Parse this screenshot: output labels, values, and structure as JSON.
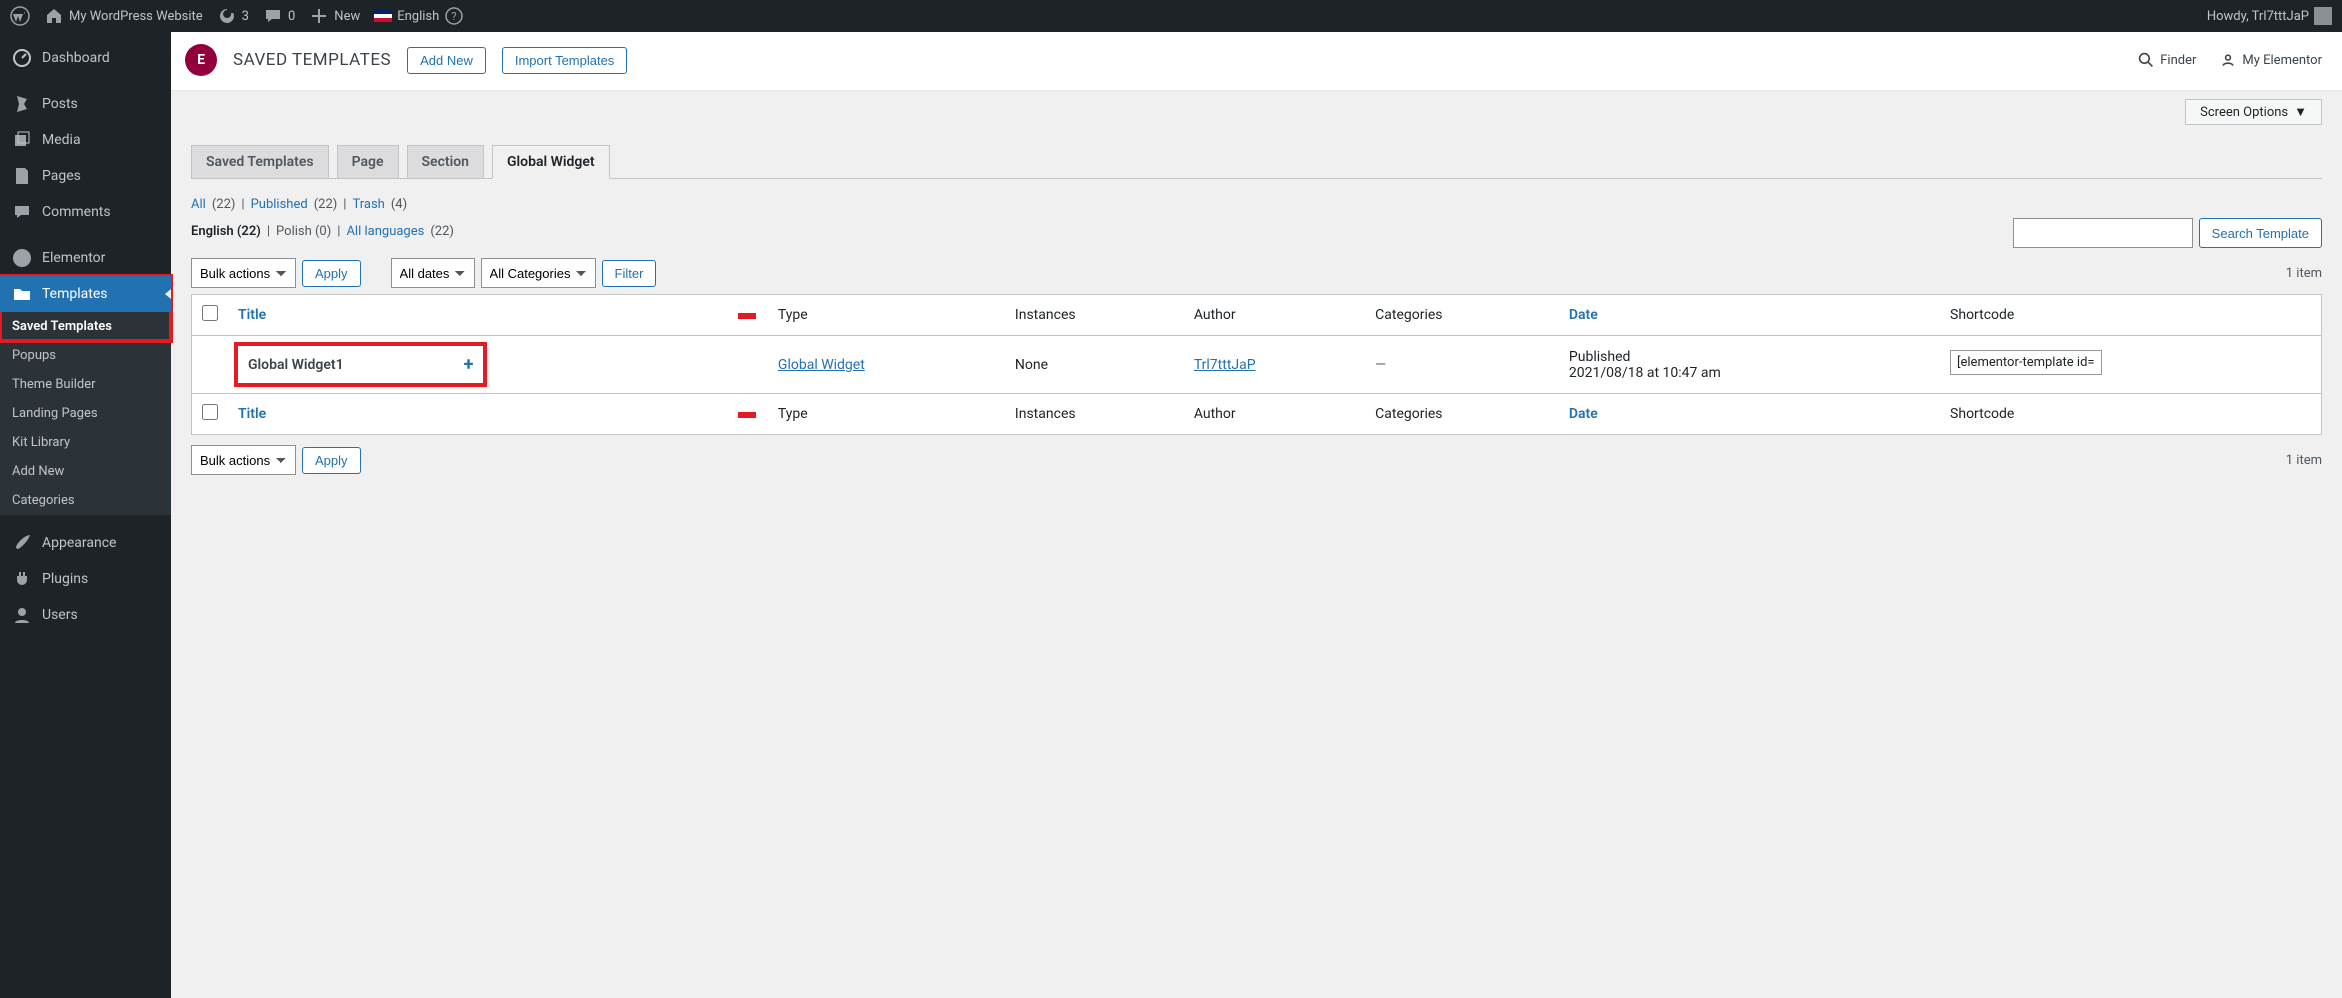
{
  "adminbar": {
    "site_name": "My WordPress Website",
    "refresh_count": "3",
    "comments_count": "0",
    "new_label": "New",
    "language_label": "English",
    "howdy": "Howdy, Trl7tttJaP"
  },
  "sidebar": {
    "items": [
      {
        "label": "Dashboard"
      },
      {
        "label": "Posts"
      },
      {
        "label": "Media"
      },
      {
        "label": "Pages"
      },
      {
        "label": "Comments"
      },
      {
        "label": "Elementor"
      },
      {
        "label": "Templates"
      },
      {
        "label": "Appearance"
      },
      {
        "label": "Plugins"
      },
      {
        "label": "Users"
      }
    ],
    "submenu": [
      {
        "label": "Saved Templates"
      },
      {
        "label": "Popups"
      },
      {
        "label": "Theme Builder"
      },
      {
        "label": "Landing Pages"
      },
      {
        "label": "Kit Library"
      },
      {
        "label": "Add New"
      },
      {
        "label": "Categories"
      }
    ]
  },
  "header": {
    "title": "SAVED TEMPLATES",
    "add_new": "Add New",
    "import": "Import Templates",
    "finder": "Finder",
    "my_elementor": "My Elementor"
  },
  "screen_options": "Screen Options",
  "tabs": [
    {
      "label": "Saved Templates"
    },
    {
      "label": "Page"
    },
    {
      "label": "Section"
    },
    {
      "label": "Global Widget"
    }
  ],
  "status_filters": {
    "all": "All",
    "all_count": "(22)",
    "published": "Published",
    "published_count": "(22)",
    "trash": "Trash",
    "trash_count": "(4)"
  },
  "lang_filters": {
    "english": "English (22)",
    "polish": "Polish (0)",
    "all": "All languages",
    "all_count": "(22)"
  },
  "search_button": "Search Template",
  "top_nav": {
    "bulk": "Bulk actions",
    "apply": "Apply",
    "all_dates": "All dates",
    "all_cats": "All Categories",
    "filter": "Filter",
    "items": "1 item"
  },
  "columns": {
    "title": "Title",
    "type": "Type",
    "instances": "Instances",
    "author": "Author",
    "categories": "Categories",
    "date": "Date",
    "shortcode": "Shortcode"
  },
  "row": {
    "title": "Global Widget1",
    "type": "Global Widget",
    "instances": "None",
    "author": "Trl7tttJaP",
    "categories": "—",
    "date_status": "Published",
    "date_value": "2021/08/18 at 10:47 am",
    "shortcode": "[elementor-template id="
  }
}
